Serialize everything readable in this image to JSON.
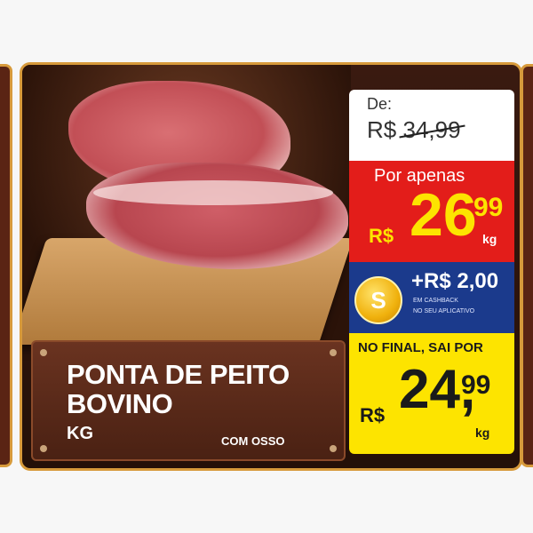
{
  "product": {
    "name_line1": "PONTA DE PEITO",
    "name_line2": "BOVINO",
    "unit": "KG",
    "note": "COM OSSO"
  },
  "price_before": {
    "label": "De:",
    "currency": "R$",
    "value": "34,99"
  },
  "price_offer": {
    "label": "Por apenas",
    "currency": "R$",
    "integer": "26",
    "decimals": "99",
    "unit": "kg",
    "color": "#e31d1a"
  },
  "cashback": {
    "amount": "+R$ 2,00",
    "fine_line1": "EM CASHBACK",
    "fine_line2": "NO SEU APLICATIVO",
    "icon": "coin-s-icon",
    "color": "#1b3a8c"
  },
  "price_final": {
    "label": "NO FINAL, SAI POR",
    "currency": "R$",
    "integer": "24,",
    "decimals": "99",
    "unit": "kg",
    "color": "#fde400"
  },
  "colors": {
    "frame": "#d79a3b",
    "card_bg": "#3a1a10"
  }
}
